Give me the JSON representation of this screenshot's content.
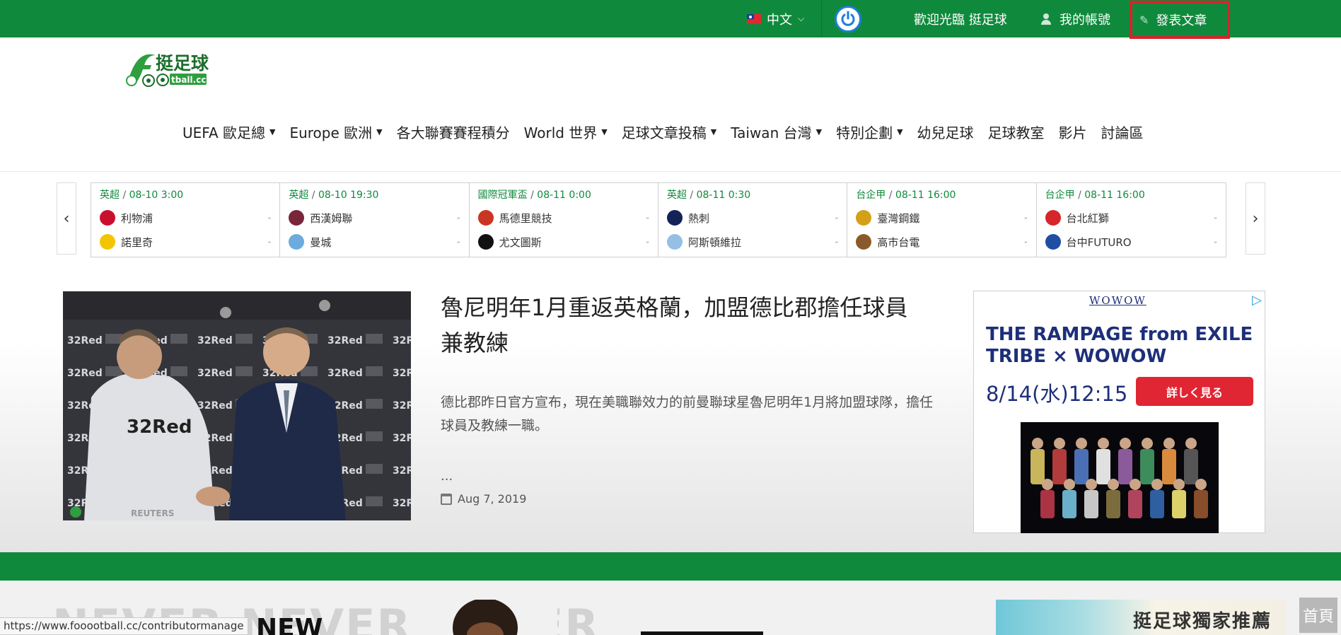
{
  "topbar": {
    "language": "中文",
    "welcome": "歡迎光臨 挺足球",
    "account": "我的帳號",
    "post_article": "發表文章"
  },
  "logo": {
    "brand_cn": "挺足球",
    "brand_en": "tball.cc"
  },
  "nav": {
    "items": [
      {
        "label": "UEFA 歐足總",
        "dropdown": true
      },
      {
        "label": "Europe 歐洲",
        "dropdown": true
      },
      {
        "label": "各大聯賽賽程積分",
        "dropdown": false
      },
      {
        "label": "World 世界",
        "dropdown": true
      },
      {
        "label": "足球文章投稿",
        "dropdown": true
      },
      {
        "label": "Taiwan 台灣",
        "dropdown": true
      },
      {
        "label": "特別企劃",
        "dropdown": true
      },
      {
        "label": "幼兒足球",
        "dropdown": false
      },
      {
        "label": "足球教室",
        "dropdown": false
      },
      {
        "label": "影片",
        "dropdown": false
      },
      {
        "label": "討論區",
        "dropdown": false
      }
    ]
  },
  "matches": [
    {
      "league": "英超",
      "time": "08-10 3:00",
      "home": "利物浦",
      "away": "諾里奇",
      "home_score": "-",
      "away_score": "-",
      "home_color": "#c8102e",
      "away_color": "#f2c500"
    },
    {
      "league": "英超",
      "time": "08-10 19:30",
      "home": "西漢姆聯",
      "away": "曼城",
      "home_score": "-",
      "away_score": "-",
      "home_color": "#7a263a",
      "away_color": "#6cabdd"
    },
    {
      "league": "國際冠軍盃",
      "time": "08-11 0:00",
      "home": "馬德里競技",
      "away": "尤文圖斯",
      "home_score": "-",
      "away_score": "-",
      "home_color": "#cb3524",
      "away_color": "#111111"
    },
    {
      "league": "英超",
      "time": "08-11 0:30",
      "home": "熱刺",
      "away": "阿斯頓維拉",
      "home_score": "-",
      "away_score": "-",
      "home_color": "#132257",
      "away_color": "#95bfe5"
    },
    {
      "league": "台企甲",
      "time": "08-11 16:00",
      "home": "臺灣鋼鐵",
      "away": "高市台電",
      "home_score": "-",
      "away_score": "-",
      "home_color": "#d4a017",
      "away_color": "#8b5a2b"
    },
    {
      "league": "台企甲",
      "time": "08-11 16:00",
      "home": "台北紅獅",
      "away": "台中FUTURO",
      "home_score": "-",
      "away_score": "-",
      "home_color": "#d6262b",
      "away_color": "#1f4ea3"
    }
  ],
  "article": {
    "title": "魯尼明年1月重返英格蘭，加盟德比郡擔任球員兼教練",
    "excerpt": "德比郡昨日官方宣布，現在美職聯效力的前曼聯球星魯尼明年1月將加盟球隊，擔任球員及教練一職。",
    "more": "...",
    "date": "Aug 7, 2019"
  },
  "ad": {
    "brand": "WOWOW",
    "headline": "THE RAMPAGE from EXILE TRIBE × WOWOW",
    "airtime": "8/14(水)12:15",
    "cta": "詳しく見る"
  },
  "lower": {
    "banner_text": "NEVER NEVER NEVER",
    "new_label": "NEW",
    "promo": "挺足球獨家推薦",
    "home_button": "首頁"
  },
  "status_url": "https://www.fooootball.cc/contributormanage"
}
